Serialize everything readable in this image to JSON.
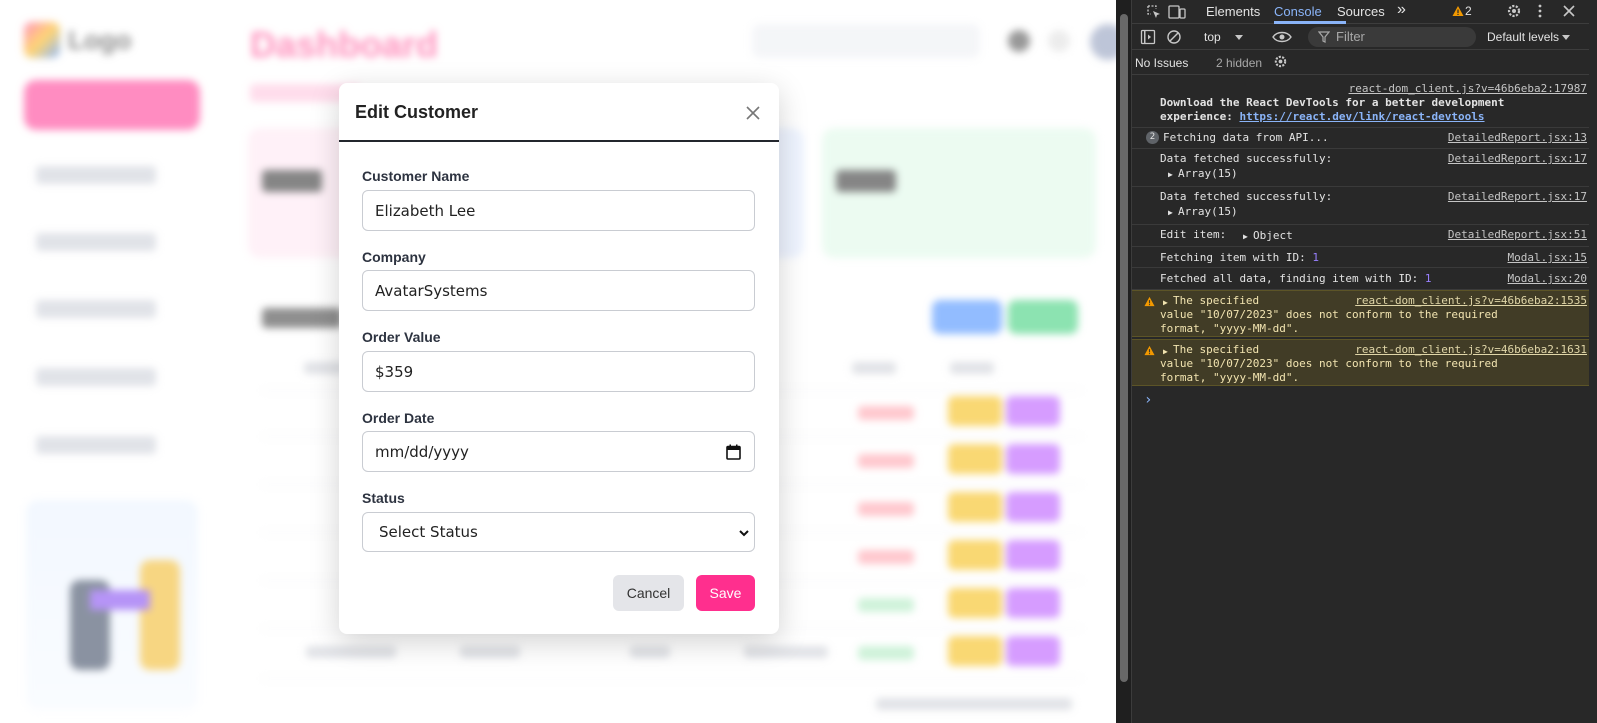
{
  "app": {
    "logo_text": "Logo",
    "page_title": "Dashboard"
  },
  "modal": {
    "title": "Edit Customer",
    "fields": {
      "customer_name": {
        "label": "Customer Name",
        "value": "Elizabeth Lee"
      },
      "company": {
        "label": "Company",
        "value": "AvatarSystems"
      },
      "order_value": {
        "label": "Order Value",
        "value": "$359"
      },
      "order_date": {
        "label": "Order Date",
        "placeholder": "mm/dd/yyyy"
      },
      "status": {
        "label": "Status",
        "selected": "Select Status"
      }
    },
    "cancel_label": "Cancel",
    "save_label": "Save",
    "accent_color": "#ff2f8e"
  },
  "devtools": {
    "tabs": {
      "elements": "Elements",
      "console": "Console",
      "sources": "Sources",
      "more": "»"
    },
    "warning_count": "2",
    "toolbar": {
      "context": "top",
      "filter_placeholder": "Filter",
      "levels": "Default levels"
    },
    "issues": {
      "label": "No Issues",
      "hidden": "2 hidden"
    },
    "logs": {
      "l1_src": "react-dom_client.js?v=46b6eba2:17987",
      "l1_text_a": "Download the React DevTools for a better development",
      "l1_text_b": "experience: ",
      "l1_link": "https://react.dev/link/react-devtools",
      "l2_count": "2",
      "l2_text": "Fetching data from API...",
      "l2_src": "DetailedReport.jsx:13",
      "l3_text": "Data fetched successfully:",
      "l3_src": "DetailedReport.jsx:17",
      "l3_sub": "Array(15)",
      "l4_text": "Data fetched successfully:",
      "l4_src": "DetailedReport.jsx:17",
      "l4_sub": "Array(15)",
      "l5_text": "Edit item: ",
      "l5_obj": "Object",
      "l5_src": "DetailedReport.jsx:51",
      "l6_text": "Fetching item with ID: ",
      "l6_num": "1",
      "l6_src": "Modal.jsx:15",
      "l7_text": "Fetched all data, finding item with ID: ",
      "l7_num": "1",
      "l7_src": "Modal.jsx:20",
      "w1_a": "The specified",
      "w1_src": "react-dom_client.js?v=46b6eba2:1535",
      "w1_b": "value \"10/07/2023\" does not conform to the required",
      "w1_c": "format, \"yyyy-MM-dd\".",
      "w2_a": "The specified",
      "w2_src": "react-dom_client.js?v=46b6eba2:1631",
      "w2_b": "value \"10/07/2023\" does not conform to the required",
      "w2_c": "format, \"yyyy-MM-dd\"."
    },
    "prompt": "›"
  }
}
